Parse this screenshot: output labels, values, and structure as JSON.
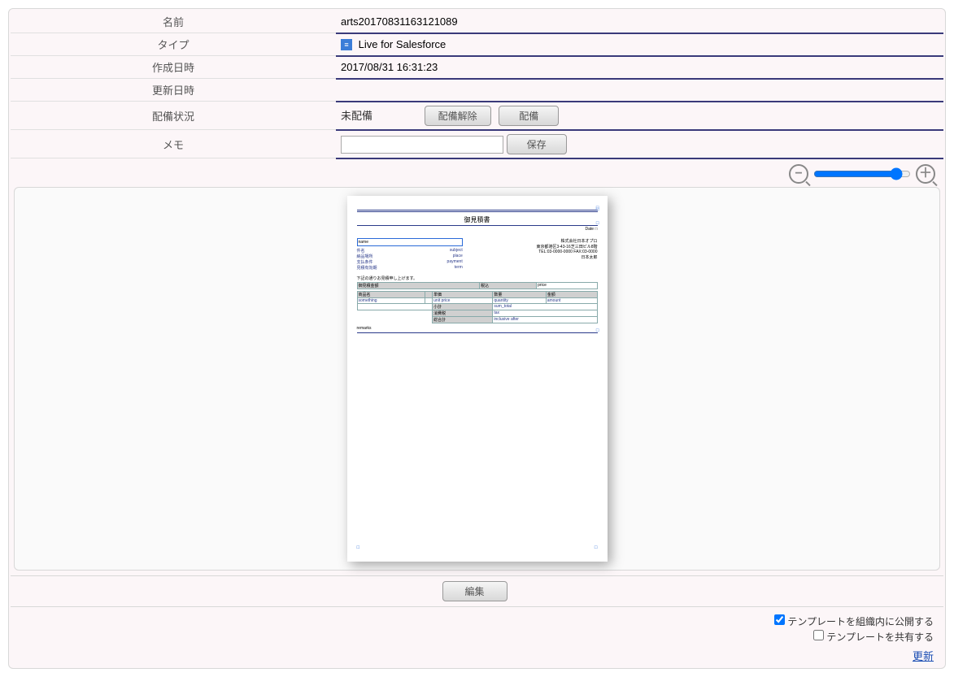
{
  "fields": {
    "name_label": "名前",
    "name_value": "arts20170831163121089",
    "type_label": "タイプ",
    "type_value": "Live for Salesforce",
    "created_label": "作成日時",
    "created_value": "2017/08/31 16:31:23",
    "updated_label": "更新日時",
    "updated_value": "",
    "deploy_label": "配備状況",
    "deploy_status": "未配備",
    "undeploy_btn": "配備解除",
    "deploy_btn": "配備",
    "memo_label": "メモ",
    "memo_value": "",
    "save_btn": "保存"
  },
  "zoom": {
    "minus": "−",
    "plus": "＋"
  },
  "preview": {
    "title": "御見積書",
    "date_label": "Date",
    "name_field": "name",
    "rows": [
      [
        "件名",
        "subject"
      ],
      [
        "納品場所",
        "place"
      ],
      [
        "支払条件",
        "payment"
      ],
      [
        "見積有効期",
        "term"
      ]
    ],
    "company": "株式会社日本オプロ",
    "address": "東京都港区3-43-16芝三田ビル8階",
    "tel": "TEL:03-0000-0000  FAX:03-0000",
    "person": "日本太郎",
    "message": "下記の通りお見積申し上げます。",
    "total_label": "御見積金額",
    "tax_toggle": "税込",
    "price_label": "price",
    "headers": [
      "商品名",
      "",
      "単価",
      "数量",
      "金額"
    ],
    "row_labels": [
      "something",
      "unit price",
      "quantity",
      "amount"
    ],
    "sum_rows": [
      [
        "小計",
        "sum_total"
      ],
      [
        "消費税",
        "tax"
      ],
      [
        "総合計",
        "inclusive after"
      ]
    ],
    "remarks": "remarks"
  },
  "edit_btn": "編集",
  "options": {
    "publish_label": "テンプレートを組織内に公開する",
    "share_label": "テンプレートを共有する"
  },
  "update_link": "更新"
}
